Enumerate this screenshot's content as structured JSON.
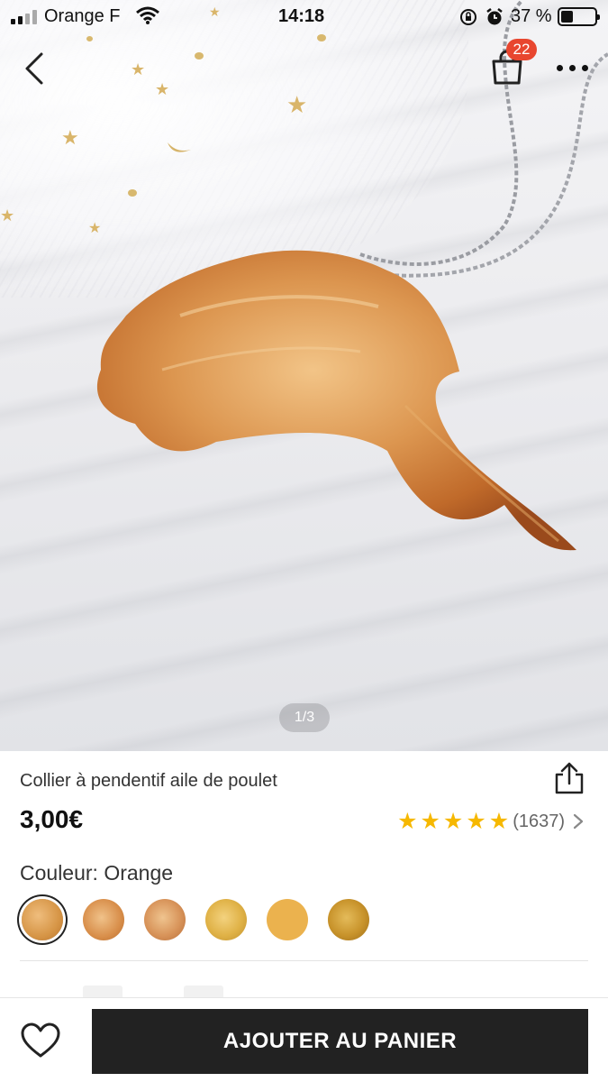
{
  "status_bar": {
    "carrier": "Orange F",
    "time": "14:18",
    "battery": "37 %"
  },
  "header": {
    "cart_count": "22"
  },
  "gallery": {
    "page_indicator": "1/3"
  },
  "product": {
    "title": "Collier à pendentif aile de poulet",
    "price": "3,00€",
    "rating_stars": 5,
    "review_count": "(1637)",
    "color_label": "Couleur: Orange"
  },
  "bottom_bar": {
    "add_to_cart_label": "AJOUTER AU PANIER"
  },
  "colors": {
    "accent_badge": "#e8462f",
    "star": "#f6b800",
    "button_dark": "#222222"
  },
  "icons": [
    "back-icon",
    "shopping-bag-icon",
    "more-icon",
    "share-icon",
    "star-icon",
    "chevron-right-icon",
    "heart-icon",
    "wifi-icon",
    "battery-icon",
    "signal-icon",
    "orientation-lock-icon",
    "alarm-icon"
  ]
}
